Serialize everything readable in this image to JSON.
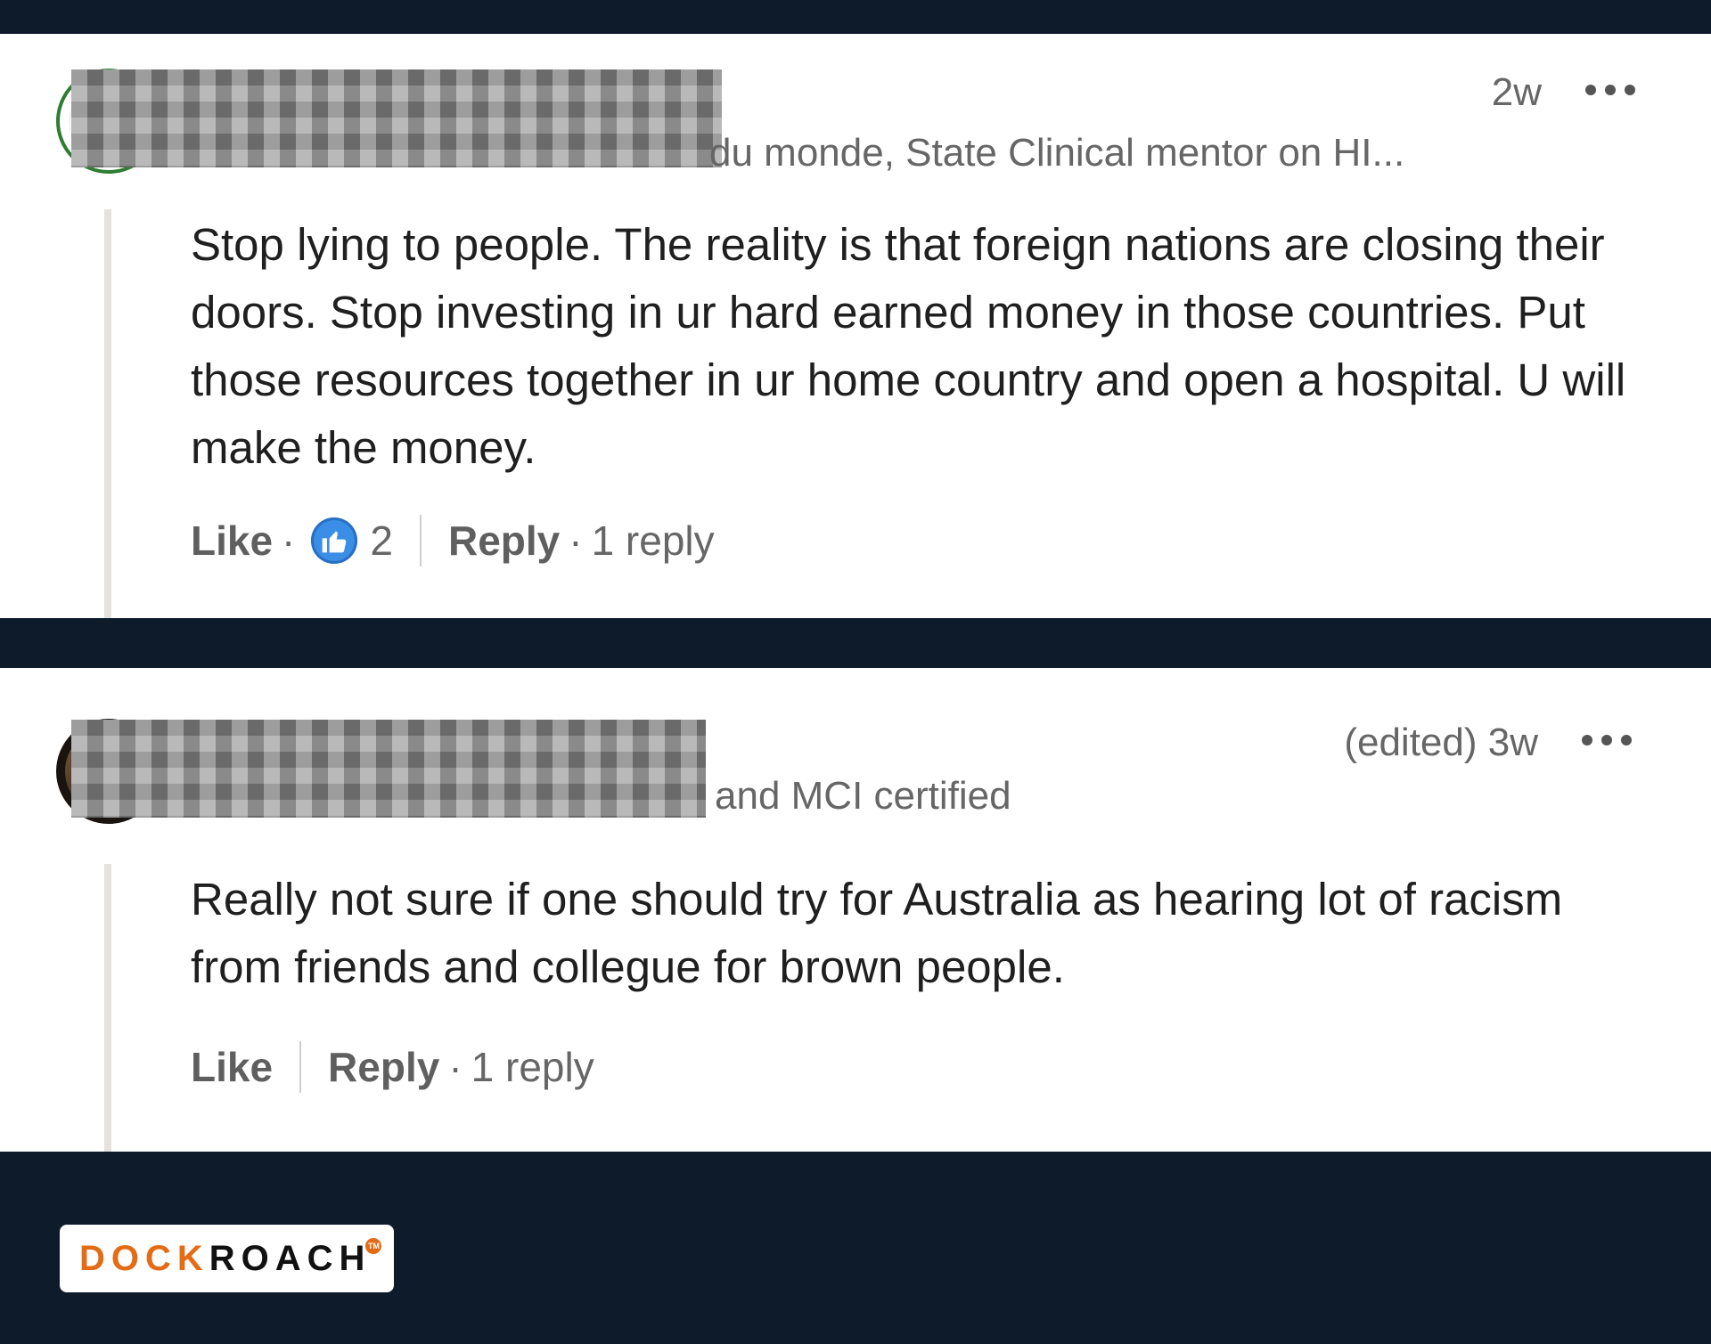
{
  "comments": [
    {
      "headline": "du monde, State Clinical mentor on HI...",
      "time": "2w",
      "body": "Stop lying to people. The reality is that foreign nations are closing their doors. Stop investing in ur hard earned money in those countries. Put those resources together in ur home country and open a hospital. U will make the money.",
      "like_label": "Like",
      "reaction_count": "2",
      "reply_label": "Reply",
      "replies": "1 reply"
    },
    {
      "headline": "and MCI certified",
      "time": "(edited) 3w",
      "body": "Really not sure if one should try for Australia as hearing lot of racism from friends and collegue for brown people.",
      "like_label": "Like",
      "reply_label": "Reply",
      "replies": "1 reply"
    }
  ],
  "brand": {
    "part1": "DOCK",
    "part2": "ROACH",
    "tm": "TM",
    "accent_color": "#e46c16",
    "background_color": "#0d1b2a"
  }
}
